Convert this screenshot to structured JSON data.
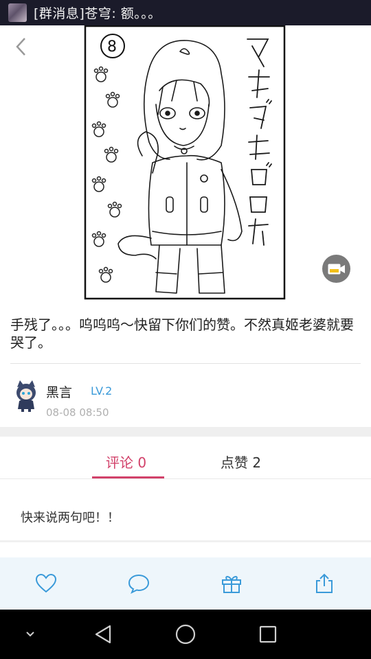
{
  "notification": {
    "text": "[群消息]苍穹: 额。。。"
  },
  "post": {
    "text": "手残了。。。呜呜呜～快留下你们的赞。不然真姬老婆就要哭了。"
  },
  "author": {
    "name": "黑言",
    "level": "LV.2",
    "time": "08-08 08:50"
  },
  "tabs": {
    "comments": "评论 0",
    "likes": "点赞 2"
  },
  "comments": {
    "empty_hint": "快来说两句吧！！"
  },
  "colors": {
    "accent": "#d2416a",
    "level": "#3a9ad9",
    "action_icon": "#3a9ad9"
  }
}
